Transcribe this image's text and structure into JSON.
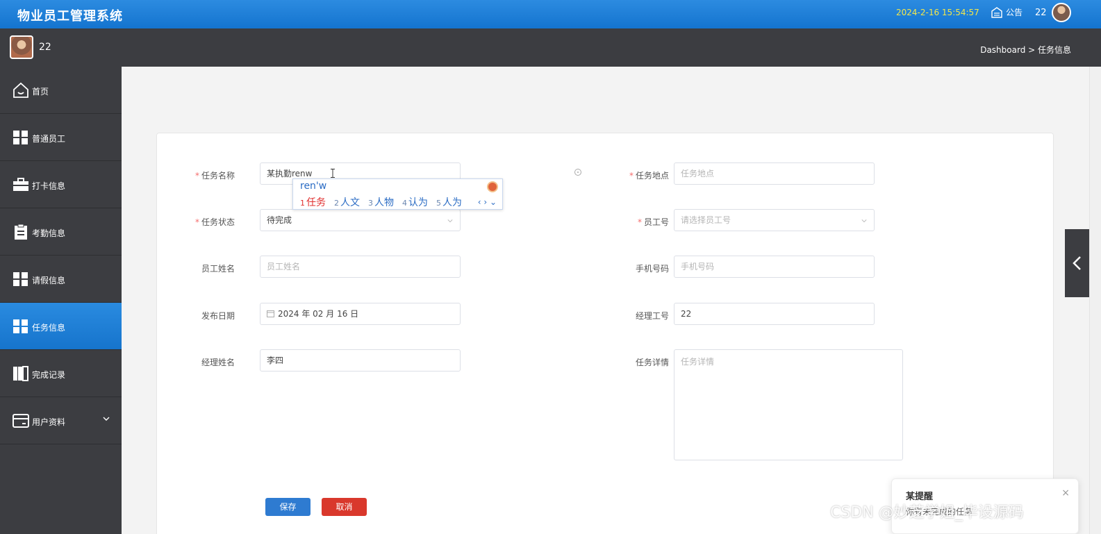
{
  "header": {
    "title": "物业员工管理系统",
    "datetime": "2024-2-16 15:54:57",
    "notice_label": "公告",
    "username": "22"
  },
  "subbar": {
    "username": "22",
    "breadcrumb": "Dashboard > 任务信息"
  },
  "sidebar": {
    "items": [
      {
        "label": "首页",
        "icon": "home-icon"
      },
      {
        "label": "普通员工",
        "icon": "grid-icon"
      },
      {
        "label": "打卡信息",
        "icon": "briefcase-icon"
      },
      {
        "label": "考勤信息",
        "icon": "clipboard-icon"
      },
      {
        "label": "请假信息",
        "icon": "grid-icon"
      },
      {
        "label": "任务信息",
        "icon": "grid-icon",
        "active": true
      },
      {
        "label": "完成记录",
        "icon": "book-icon"
      },
      {
        "label": "用户资料",
        "icon": "card-icon",
        "expandable": true
      }
    ]
  },
  "form": {
    "task_name": {
      "label": "任务名称",
      "value": "某执勤renw",
      "required": true
    },
    "task_location": {
      "label": "任务地点",
      "placeholder": "任务地点",
      "required": true
    },
    "task_status": {
      "label": "任务状态",
      "value": "待完成",
      "required": true
    },
    "employee_no": {
      "label": "员工号",
      "placeholder": "请选择员工号",
      "required": true
    },
    "employee_name": {
      "label": "员工姓名",
      "placeholder": "员工姓名"
    },
    "phone": {
      "label": "手机号码",
      "placeholder": "手机号码"
    },
    "publish_date": {
      "label": "发布日期",
      "value": "2024 年 02 月 16 日"
    },
    "manager_no": {
      "label": "经理工号",
      "value": "22"
    },
    "manager_name": {
      "label": "经理姓名",
      "value": "李四"
    },
    "task_detail": {
      "label": "任务详情",
      "placeholder": "任务详情"
    },
    "save_label": "保存",
    "cancel_label": "取消"
  },
  "ime": {
    "pinyin": "ren'w",
    "candidates": [
      {
        "n": "1",
        "text": "任务"
      },
      {
        "n": "2",
        "text": "人文"
      },
      {
        "n": "3",
        "text": "人物"
      },
      {
        "n": "4",
        "text": "认为"
      },
      {
        "n": "5",
        "text": "人为"
      }
    ]
  },
  "toast": {
    "title": "某提醒",
    "message": "你有未完成的任务",
    "close": "×"
  },
  "watermark": "CSDN @妙芝学姐_毕设源码"
}
